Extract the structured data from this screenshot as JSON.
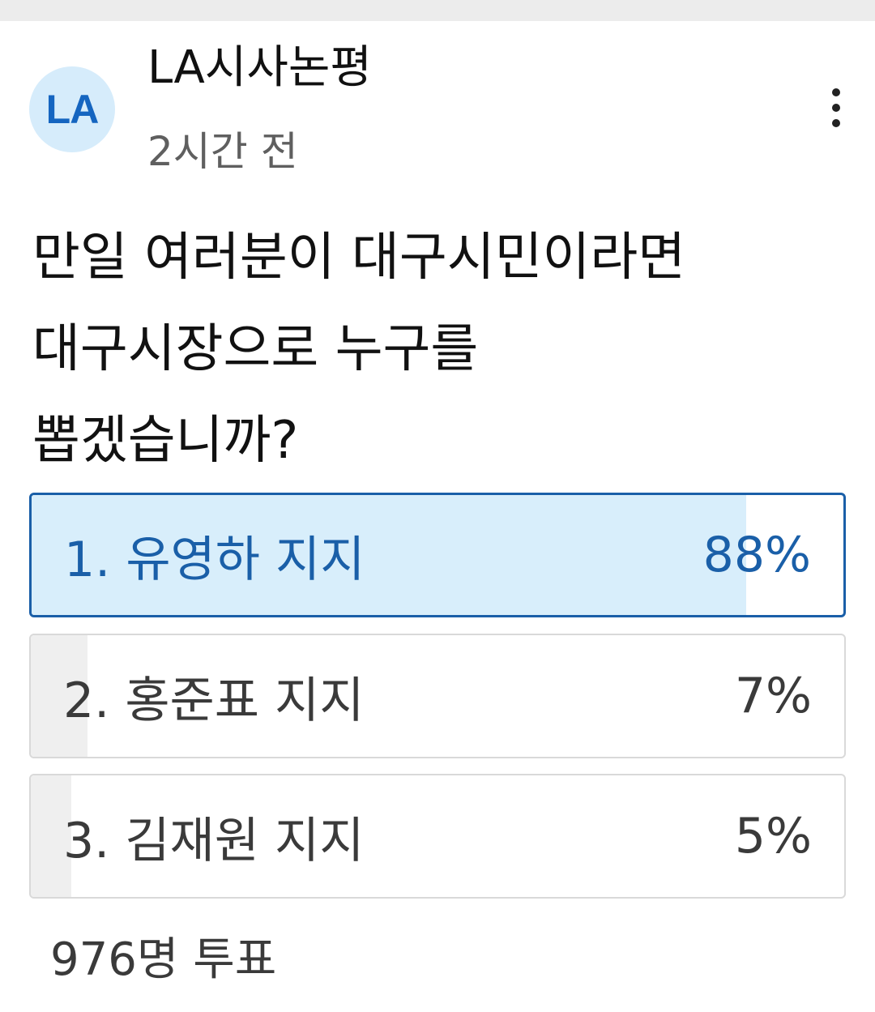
{
  "post": {
    "avatar_text": "LA",
    "channel_name": "LA시사논평",
    "time": "2시간 전",
    "more_icon": "more-vertical-icon"
  },
  "poll": {
    "question_lines": [
      "만일 여러분이 대구시민이라면",
      "대구시장으로 누구를",
      "뽑겠습니까?"
    ],
    "options": [
      {
        "label": "1. 유영하 지지",
        "percent_text": "88%",
        "percent": 88,
        "selected": true
      },
      {
        "label": "2. 홍준표 지지",
        "percent_text": "7%",
        "percent": 7,
        "selected": false
      },
      {
        "label": "3. 김재원 지지",
        "percent_text": "5%",
        "percent": 5,
        "selected": false
      }
    ],
    "vote_count": "976명 투표"
  },
  "colors": {
    "accent": "#1a5fa8",
    "selected_fill": "#d8eefb",
    "option_fill": "#efefef",
    "avatar_bg": "#d6ecfb",
    "avatar_text": "#1565c0"
  }
}
